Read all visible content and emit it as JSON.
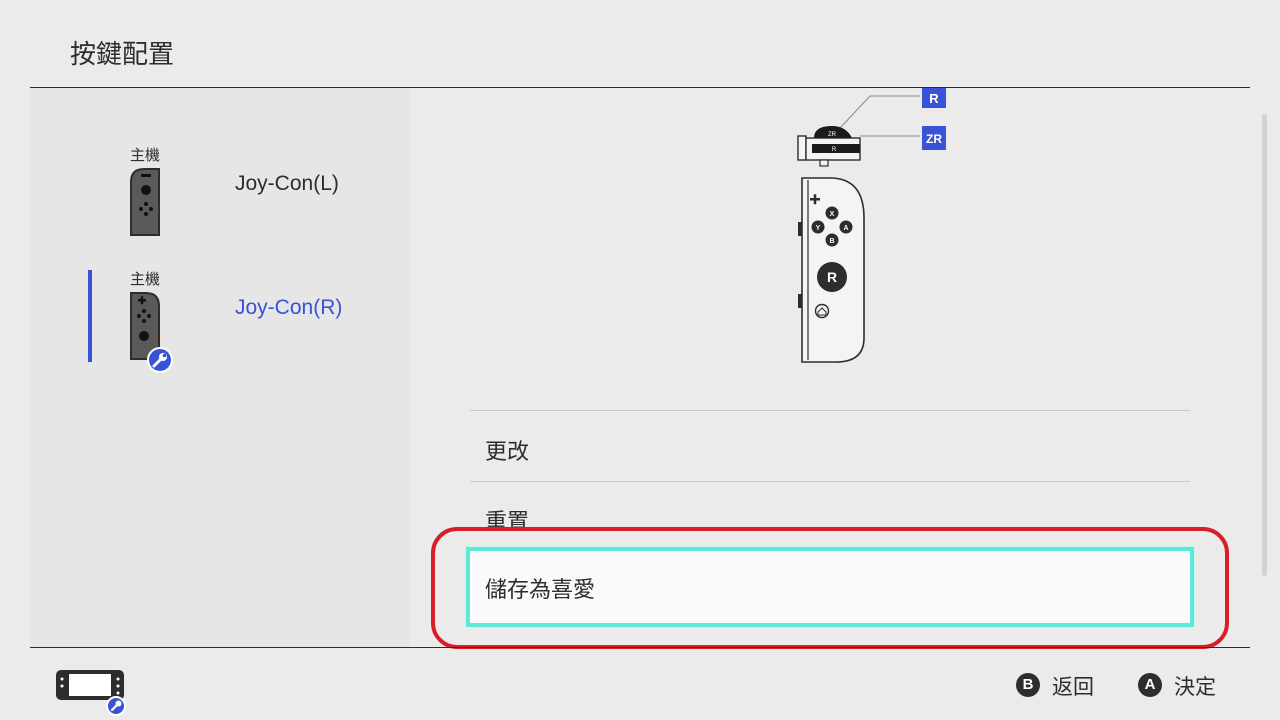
{
  "header": {
    "title": "按鍵配置"
  },
  "sidebar": {
    "items": [
      {
        "sub": "主機",
        "name": "Joy-Con(L)",
        "icon": "joycon-left-icon",
        "selected": false
      },
      {
        "sub": "主機",
        "name": "Joy-Con(R)",
        "icon": "joycon-right-icon",
        "selected": true,
        "badge": "wrench-icon"
      }
    ]
  },
  "diagram": {
    "labels": {
      "r": "R",
      "zr": "ZR",
      "r_symbol": "R",
      "zr_badge": "ZR"
    },
    "buttons": [
      "X",
      "Y",
      "A",
      "B"
    ],
    "stick_label": "R"
  },
  "menu": {
    "items": [
      {
        "label": "更改"
      },
      {
        "label": "重置"
      },
      {
        "label": "儲存為喜愛",
        "focused": true
      }
    ]
  },
  "footer": {
    "hints": [
      {
        "button": "B",
        "label": "返回"
      },
      {
        "button": "A",
        "label": "決定"
      }
    ]
  },
  "colors": {
    "accent": "#3a52d6",
    "focus": "#5fe8d8",
    "annotation": "#d61f26",
    "background": "#ebebeb"
  }
}
